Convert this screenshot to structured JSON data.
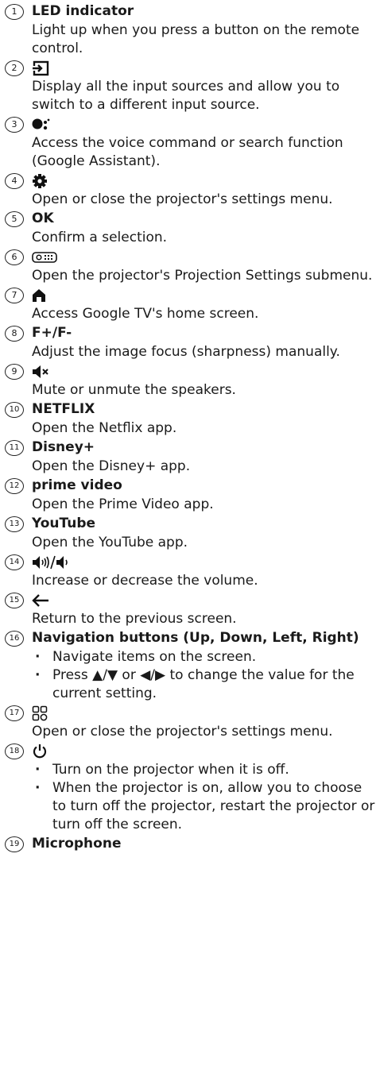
{
  "items": [
    {
      "num": "1",
      "title": "LED indicator",
      "desc": "Light up when you press a button on the remote control."
    },
    {
      "num": "2",
      "icon": "input-source-icon",
      "desc": "Display all the input sources and allow you to switch to a different input source."
    },
    {
      "num": "3",
      "icon": "google-assistant-icon",
      "desc": "Access the voice command or search function (Google Assistant)."
    },
    {
      "num": "4",
      "icon": "gear-icon",
      "desc": "Open or close the projector's settings menu."
    },
    {
      "num": "5",
      "title": "OK",
      "desc": "Confirm a selection."
    },
    {
      "num": "6",
      "icon": "projection-settings-icon",
      "desc": "Open the projector's Projection Settings submenu."
    },
    {
      "num": "7",
      "icon": "home-icon",
      "desc": "Access Google TV's home screen."
    },
    {
      "num": "8",
      "title": "F+/F-",
      "desc": "Adjust the image focus (sharpness) manually."
    },
    {
      "num": "9",
      "icon": "mute-icon",
      "desc": "Mute or unmute the speakers."
    },
    {
      "num": "10",
      "title": "NETFLIX",
      "desc": "Open the Netflix app."
    },
    {
      "num": "11",
      "title": "Disney+",
      "desc": "Open the Disney+ app."
    },
    {
      "num": "12",
      "title": "prime video",
      "desc": "Open the Prime Video app."
    },
    {
      "num": "13",
      "title": "YouTube",
      "desc": "Open the YouTube app."
    },
    {
      "num": "14",
      "icon": "volume-up-down-icon",
      "desc": "Increase or decrease the volume."
    },
    {
      "num": "15",
      "icon": "back-arrow-icon",
      "desc": "Return to the previous screen."
    },
    {
      "num": "16",
      "title": "Navigation buttons (Up, Down, Left, Right)",
      "bullets": [
        "Navigate items on the screen.",
        "Press ▲/▼ or ◀/▶ to change the value for the current setting."
      ]
    },
    {
      "num": "17",
      "icon": "apps-grid-icon",
      "desc": "Open or close the projector's settings menu."
    },
    {
      "num": "18",
      "icon": "power-icon",
      "bullets": [
        "Turn on the projector when it is off.",
        "When the projector is on, allow you to choose to turn off the projector, restart the projector or turn off the screen."
      ]
    },
    {
      "num": "19",
      "title": "Microphone"
    }
  ]
}
